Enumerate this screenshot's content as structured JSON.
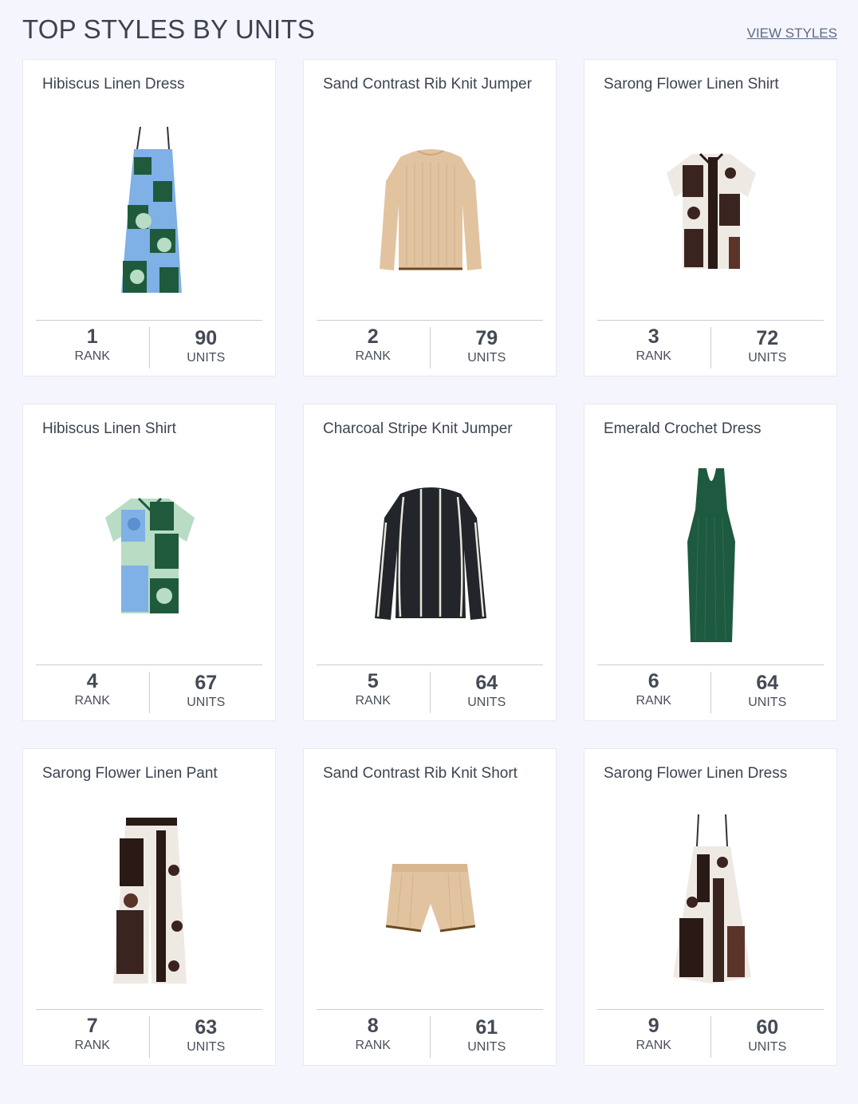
{
  "header": {
    "title": "TOP STYLES BY UNITS",
    "view_link": "VIEW STYLES"
  },
  "labels": {
    "rank": "RANK",
    "units": "UNITS"
  },
  "products": [
    {
      "name": "Hibiscus Linen Dress",
      "rank": "1",
      "units": "90",
      "icon": "dress-image"
    },
    {
      "name": "Sand Contrast Rib Knit Jumper",
      "rank": "2",
      "units": "79",
      "icon": "jumper-image"
    },
    {
      "name": "Sarong Flower Linen Shirt",
      "rank": "3",
      "units": "72",
      "icon": "shirt-image"
    },
    {
      "name": "Hibiscus Linen Shirt",
      "rank": "4",
      "units": "67",
      "icon": "shirt-image"
    },
    {
      "name": "Charcoal Stripe Knit Jumper",
      "rank": "5",
      "units": "64",
      "icon": "jumper-image"
    },
    {
      "name": "Emerald Crochet Dress",
      "rank": "6",
      "units": "64",
      "icon": "dress-image"
    },
    {
      "name": "Sarong Flower Linen Pant",
      "rank": "7",
      "units": "63",
      "icon": "pant-image"
    },
    {
      "name": "Sand Contrast Rib Knit Short",
      "rank": "8",
      "units": "61",
      "icon": "short-image"
    },
    {
      "name": "Sarong Flower Linen Dress",
      "rank": "9",
      "units": "60",
      "icon": "dress-image"
    }
  ],
  "colors": {
    "background": "#f5f5fd",
    "card": "#ffffff",
    "link": "#5a6b86",
    "hibiscus_green": "#1f5a3c",
    "hibiscus_blue": "#7fb0e6",
    "sand": "#e2c3a0",
    "charcoal": "#22262a",
    "emerald": "#1d5a40",
    "sarong_brown": "#3a2420"
  }
}
